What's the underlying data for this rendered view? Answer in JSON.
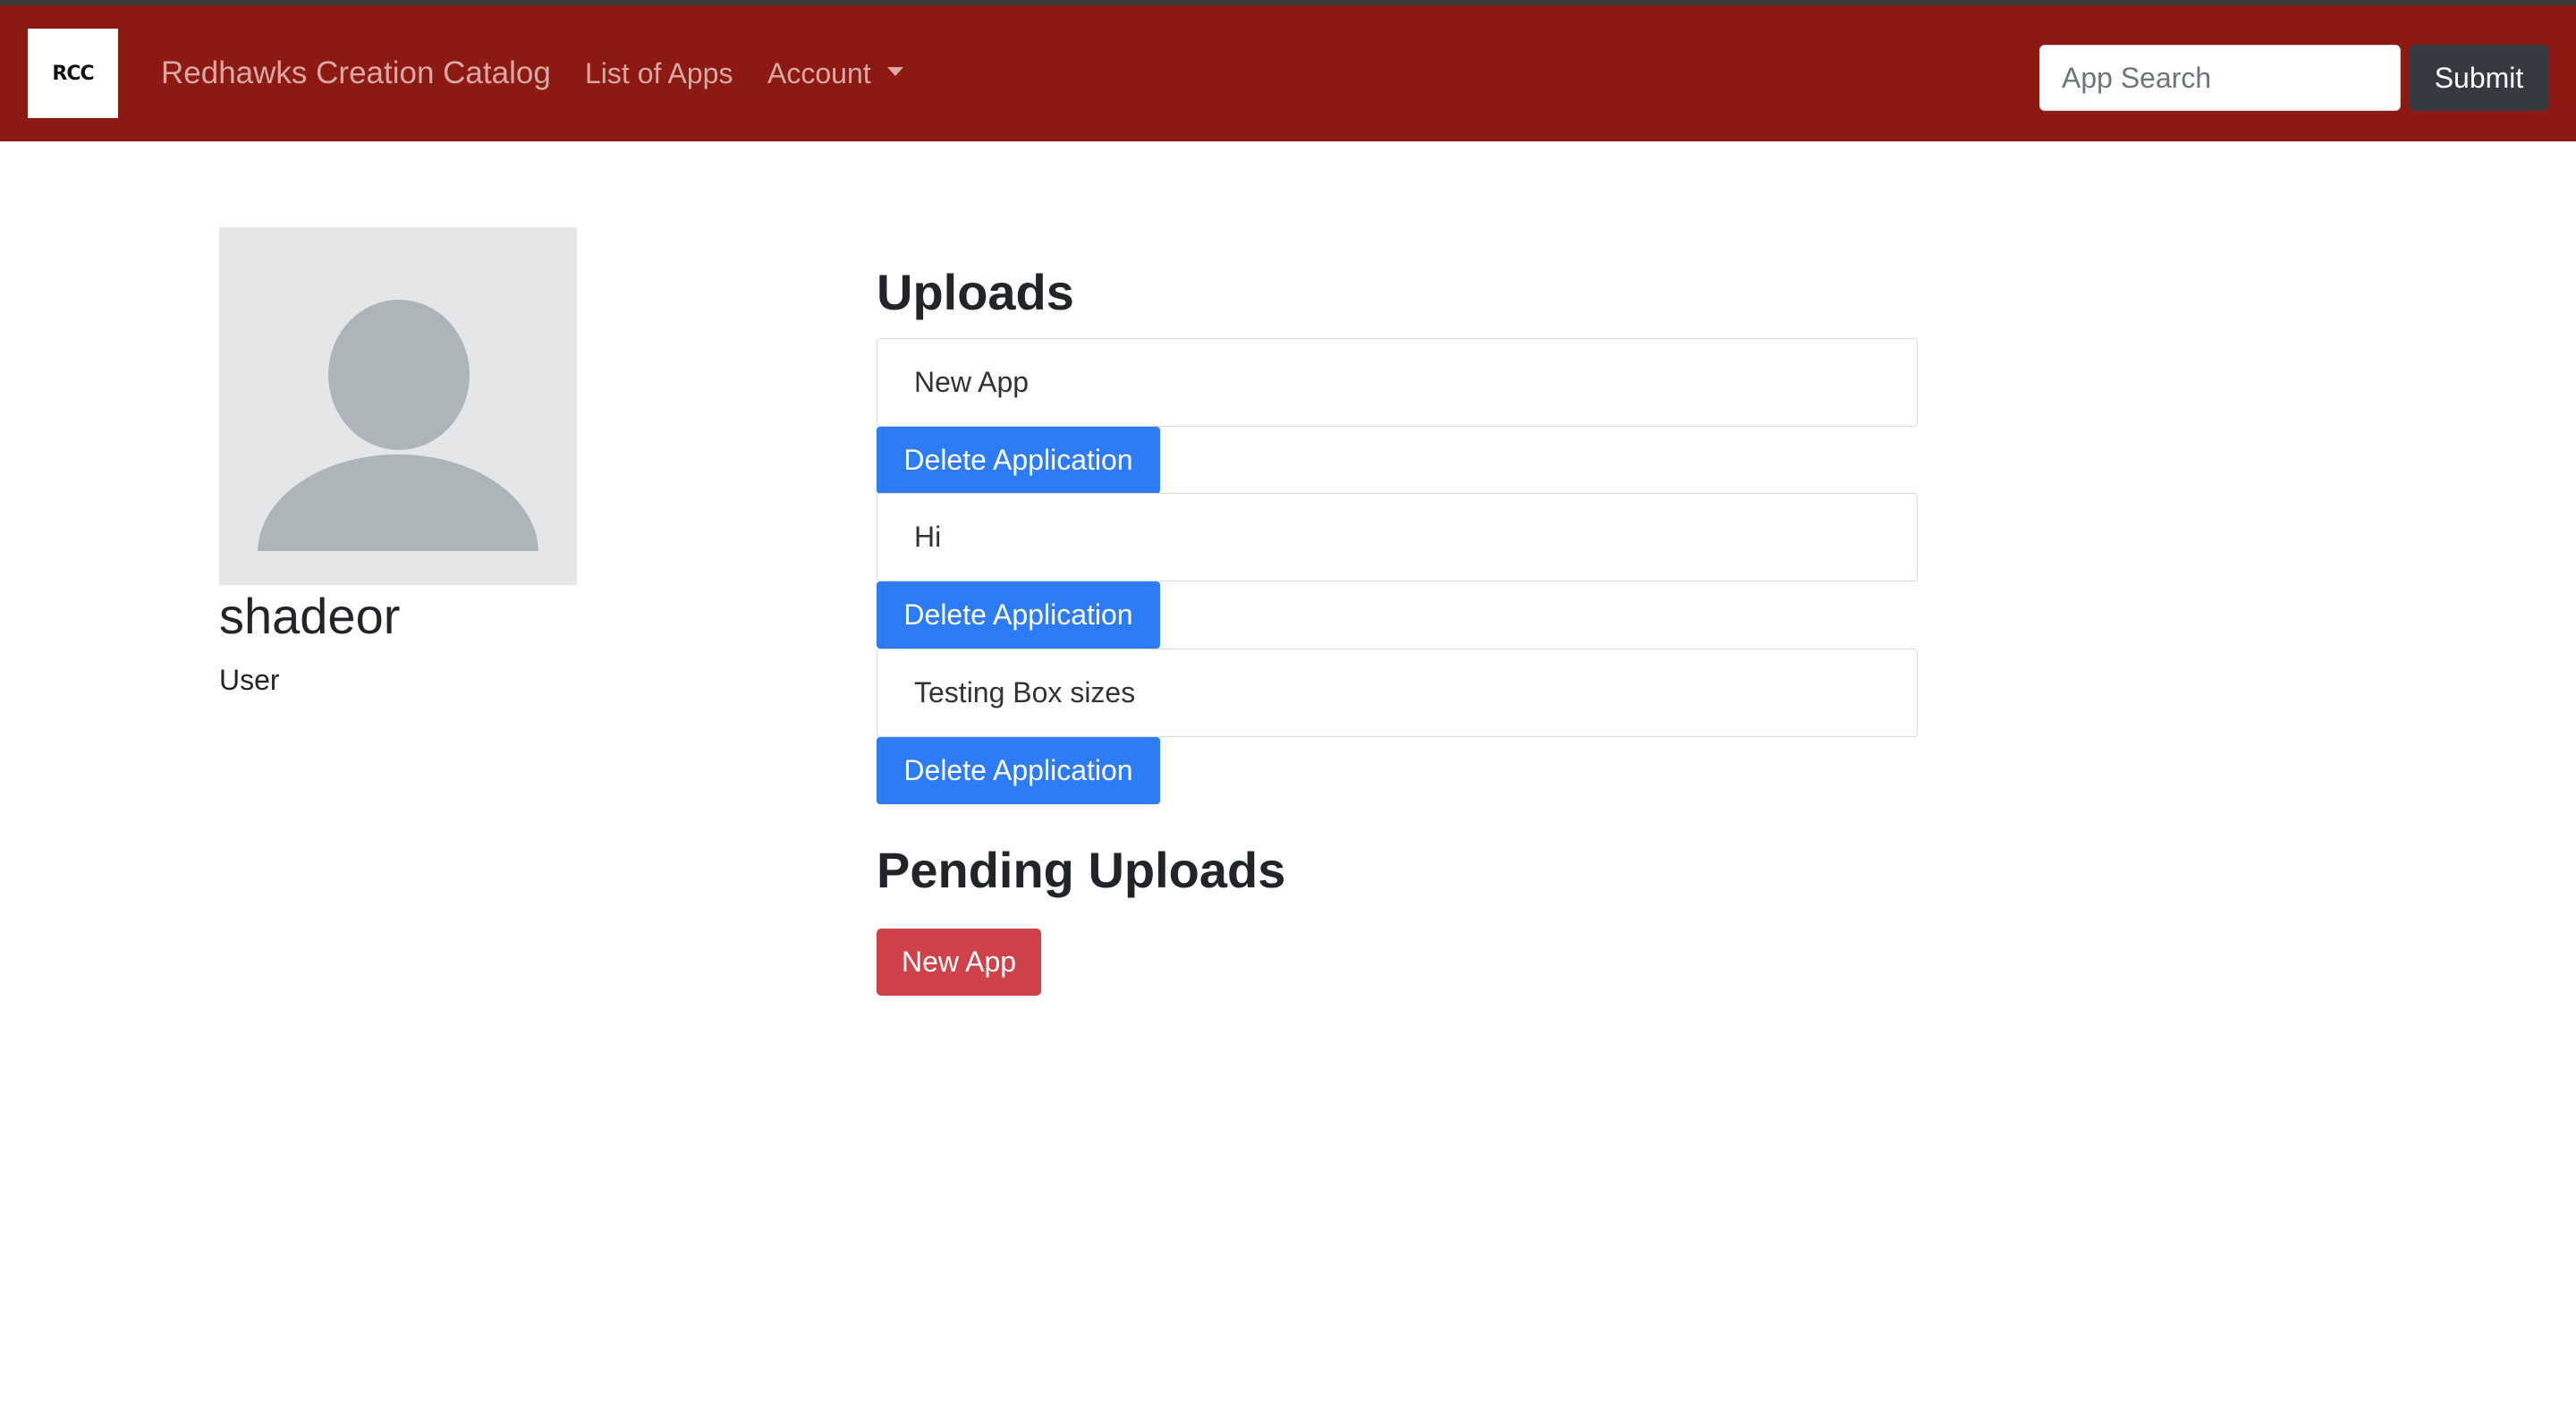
{
  "navbar": {
    "logo_text": "RCC",
    "brand": "Redhawks Creation Catalog",
    "links": {
      "list_of_apps": "List of Apps",
      "account": "Account"
    },
    "search": {
      "placeholder": "App Search",
      "value": ""
    },
    "submit_label": "Submit"
  },
  "profile": {
    "username": "shadeor",
    "role": "User"
  },
  "uploads": {
    "title": "Uploads",
    "items": [
      {
        "name": "New App",
        "action": "Delete Application"
      },
      {
        "name": "Hi",
        "action": "Delete Application"
      },
      {
        "name": "Testing Box sizes",
        "action": "Delete Application"
      }
    ]
  },
  "pending": {
    "title": "Pending Uploads",
    "items": [
      {
        "name": "New App"
      }
    ]
  },
  "colors": {
    "navbar_bg": "#8c1912",
    "delete_button": "#2d7cf6",
    "pending_button": "#d0424a",
    "submit_button": "#343a40"
  }
}
